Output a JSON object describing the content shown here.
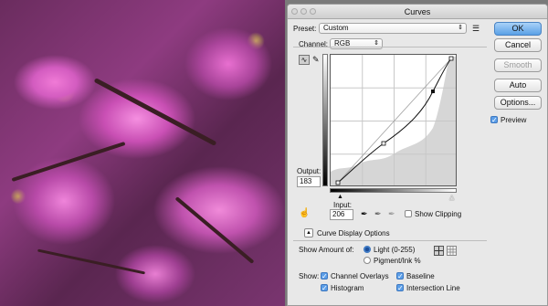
{
  "dialog": {
    "title": "Curves",
    "preset_label": "Preset:",
    "preset_value": "Custom",
    "channel_label": "Channel:",
    "channel_value": "RGB",
    "output_label": "Output:",
    "output_value": "183",
    "input_label": "Input:",
    "input_value": "206",
    "show_clipping_label": "Show Clipping",
    "curve_display_options_label": "Curve Display Options",
    "show_amount_label": "Show Amount of:",
    "light_label": "Light  (0-255)",
    "pigment_label": "Pigment/Ink %",
    "show_label": "Show:",
    "channel_overlays_label": "Channel Overlays",
    "baseline_label": "Baseline",
    "histogram_label": "Histogram",
    "intersection_line_label": "Intersection Line"
  },
  "buttons": {
    "ok": "OK",
    "cancel": "Cancel",
    "smooth": "Smooth",
    "auto": "Auto",
    "options": "Options..."
  },
  "preview_label": "Preview",
  "state": {
    "preview": true,
    "show_clipping": false,
    "light_selected": true,
    "channel_overlays": true,
    "baseline": true,
    "histogram": true,
    "intersection_line": true
  },
  "icons": {
    "preset_menu": "preset-options-icon",
    "curve_tool": "curve-point-icon",
    "pencil_tool": "pencil-icon",
    "target_adjust": "target-adjust-icon",
    "eyedroppers": [
      "black-eyedropper-icon",
      "gray-eyedropper-icon",
      "white-eyedropper-icon"
    ],
    "grid_simple": "grid-4-icon",
    "grid_detailed": "grid-10-icon"
  }
}
